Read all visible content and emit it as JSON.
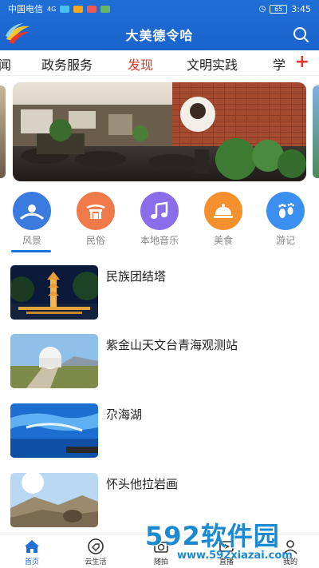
{
  "status_bar": {
    "carrier": "中国电信",
    "signal": "4G",
    "battery": "65",
    "time": "3:45"
  },
  "app": {
    "title": "大美德令哈"
  },
  "tabs": [
    {
      "label": "闻",
      "active": false
    },
    {
      "label": "政务服务",
      "active": false
    },
    {
      "label": "发现",
      "active": true
    },
    {
      "label": "文明实践",
      "active": false
    },
    {
      "label": "学",
      "active": false
    }
  ],
  "tabs_add": "+",
  "categories": [
    {
      "label": "风景",
      "icon": "landscape-icon",
      "color": "#3a7be0",
      "active": true
    },
    {
      "label": "民俗",
      "icon": "folk-custom-icon",
      "color": "#f07a4a",
      "active": false
    },
    {
      "label": "本地音乐",
      "icon": "music-note-icon",
      "color": "#8a6de8",
      "active": false
    },
    {
      "label": "美食",
      "icon": "food-cloche-icon",
      "color": "#f5902e",
      "active": false
    },
    {
      "label": "游记",
      "icon": "footprint-icon",
      "color": "#3b8ff0",
      "active": false
    }
  ],
  "articles": [
    {
      "title": "民族团结塔"
    },
    {
      "title": "紫金山天文台青海观测站"
    },
    {
      "title": "尕海湖"
    },
    {
      "title": "怀头他拉岩画"
    }
  ],
  "bottom_nav": [
    {
      "label": "首页",
      "icon": "home-icon",
      "active": true
    },
    {
      "label": "云生活",
      "icon": "tag-icon",
      "active": false
    },
    {
      "label": "随拍",
      "icon": "camera-icon",
      "active": false
    },
    {
      "label": "直播",
      "icon": "live-icon",
      "active": false
    },
    {
      "label": "我的",
      "icon": "user-icon",
      "active": false
    }
  ],
  "watermark": {
    "main": "592软件园",
    "url": "www.592xiazai.com"
  },
  "colors": {
    "brand": "#1f6fd6",
    "tab_active": "#d93a2b",
    "watermark": "#1b8ad3"
  }
}
